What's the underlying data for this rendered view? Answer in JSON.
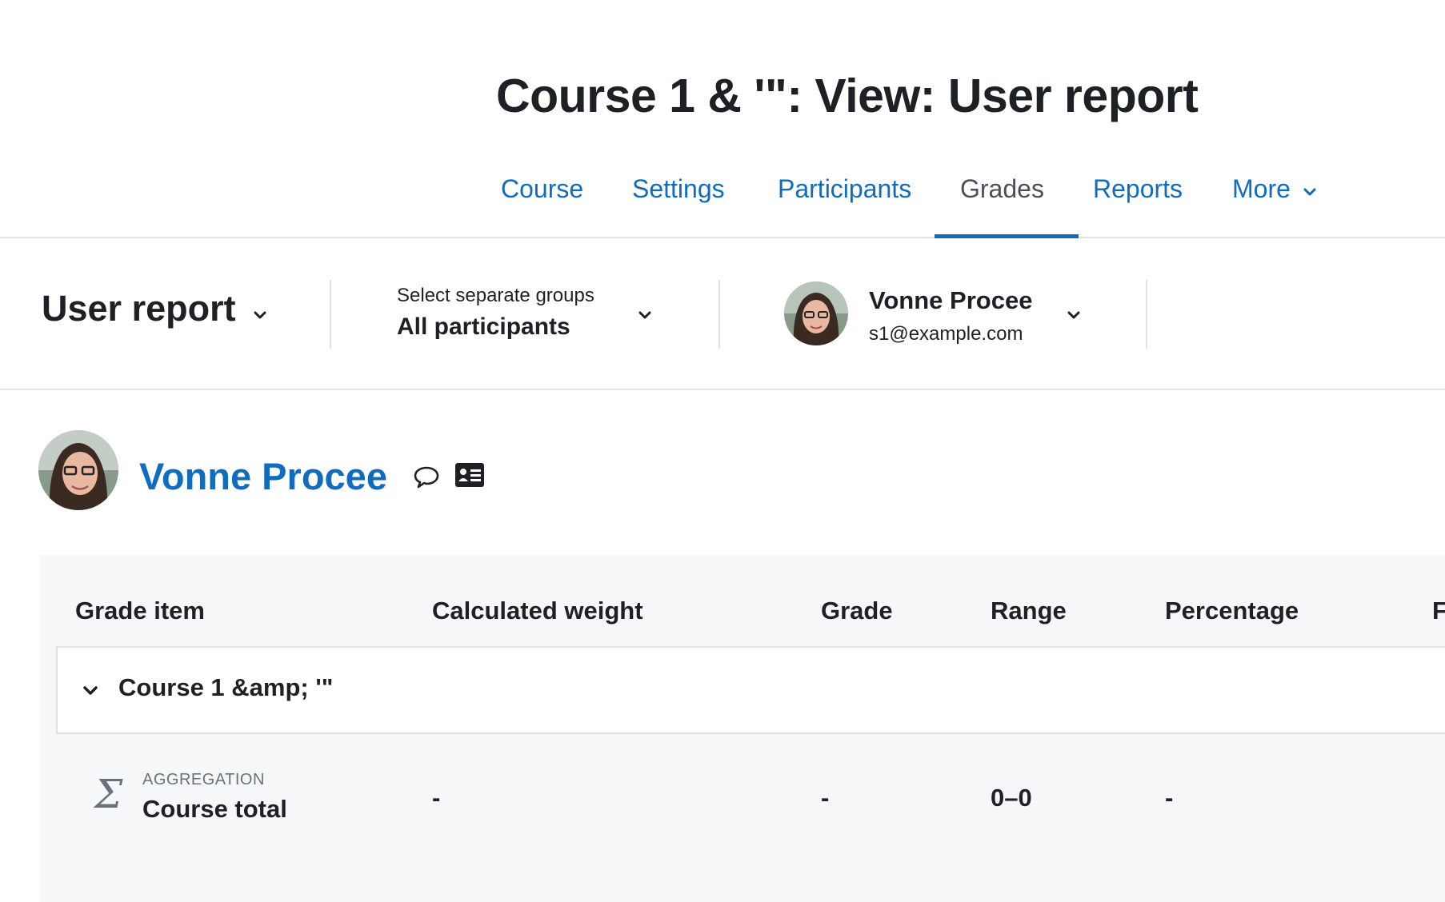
{
  "page_title": "Course 1 & '\": View: User report",
  "nav": {
    "tabs": [
      {
        "label": "Course"
      },
      {
        "label": "Settings"
      },
      {
        "label": "Participants"
      },
      {
        "label": "Grades",
        "active": true
      },
      {
        "label": "Reports"
      },
      {
        "label": "More"
      }
    ]
  },
  "tertiary": {
    "report_select": "User report",
    "group_select": {
      "label": "Select separate groups",
      "value": "All participants"
    },
    "user_select": {
      "name": "Vonne Procee",
      "email": "s1@example.com"
    }
  },
  "profile": {
    "name": "Vonne Procee",
    "icons": [
      "message-icon",
      "contact-card-icon"
    ]
  },
  "report_table": {
    "columns": [
      "Grade item",
      "Calculated weight",
      "Grade",
      "Range",
      "Percentage",
      "F"
    ],
    "category": {
      "name": "Course 1 &amp; '\""
    },
    "rows": [
      {
        "type_label": "AGGREGATION",
        "item": "Course total",
        "calculated_weight": "-",
        "grade": "-",
        "range": "0–0",
        "percentage": "-"
      }
    ]
  },
  "colors": {
    "link": "#0f6cbf",
    "text": "#1d2125",
    "muted": "#6a737b",
    "border": "#dee2e6",
    "table_bg": "#f6f7f9"
  }
}
